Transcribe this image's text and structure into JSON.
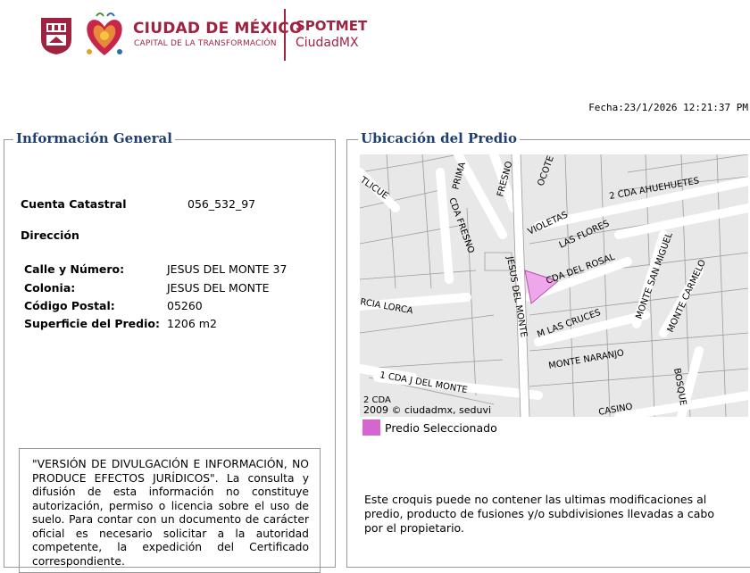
{
  "header": {
    "brand_title": "CIUDAD DE MÉXICO",
    "brand_subtitle": "CAPITAL DE LA TRANSFORMACIÓN",
    "app_title": "SPOTMET",
    "app_subtitle": "CiudadMX",
    "accent_color": "#9f2241"
  },
  "fecha": "Fecha:23/1/2026 12:21:37 PM",
  "info_general": {
    "legend": "Información General",
    "cuenta_label": "Cuenta Catastral",
    "cuenta_value": "056_532_97",
    "direccion_label": "Dirección",
    "calle_label": "Calle y Número:",
    "calle_value": "JESUS DEL MONTE 37",
    "colonia_label": "Colonia:",
    "colonia_value": "JESUS DEL MONTE",
    "cp_label": "Código Postal:",
    "cp_value": "05260",
    "superficie_label": "Superficie del Predio:",
    "superficie_value": "1206 m2",
    "disclaimer": "\"VERSIÓN DE DIVULGACIÓN E INFORMACIÓN, NO PRODUCE EFECTOS JURÍDICOS\". La consulta y difusión de esta información no constituye autorización, permiso o licencia sobre el uso de suelo. Para contar con un documento de carácter oficial es necesario solicitar a la autoridad competente, la expedición del Certificado correspondiente."
  },
  "ubicacion": {
    "legend": "Ubicación del Predio",
    "map_copyright": "2009 © ciudadmx, seduvi",
    "legend_item": "Predio Seleccionado",
    "legend_color": "#d466d1",
    "note": "Este croquis puede no contener las ultimas modificaciones al predio, producto de fusiones y/o subdivisiones llevadas a cabo por el propietario.",
    "streets": {
      "s1": "TLICUE",
      "s2": "PRIMA",
      "s3": "FRESNO",
      "s4": "OCOTE",
      "s5": "2 CDA AHUEHUETES",
      "s6": "CDA FRESNO",
      "s7": "VIOLETAS",
      "s8": "LAS FLORES",
      "s9": "CDA DEL ROSAL",
      "s10": "JESUS DEL MONTE",
      "s11": "MONTE SAN MIGUEL",
      "s12": "MONTE CARMELO",
      "s13": "RCIA LORCA",
      "s14": "M LAS CRUCES",
      "s15": "MONTE NARANJO",
      "s16": "1 CDA J DEL MONTE",
      "s17": "2 CDA",
      "s18": "CASINO",
      "s19": "BOSQUE"
    }
  }
}
